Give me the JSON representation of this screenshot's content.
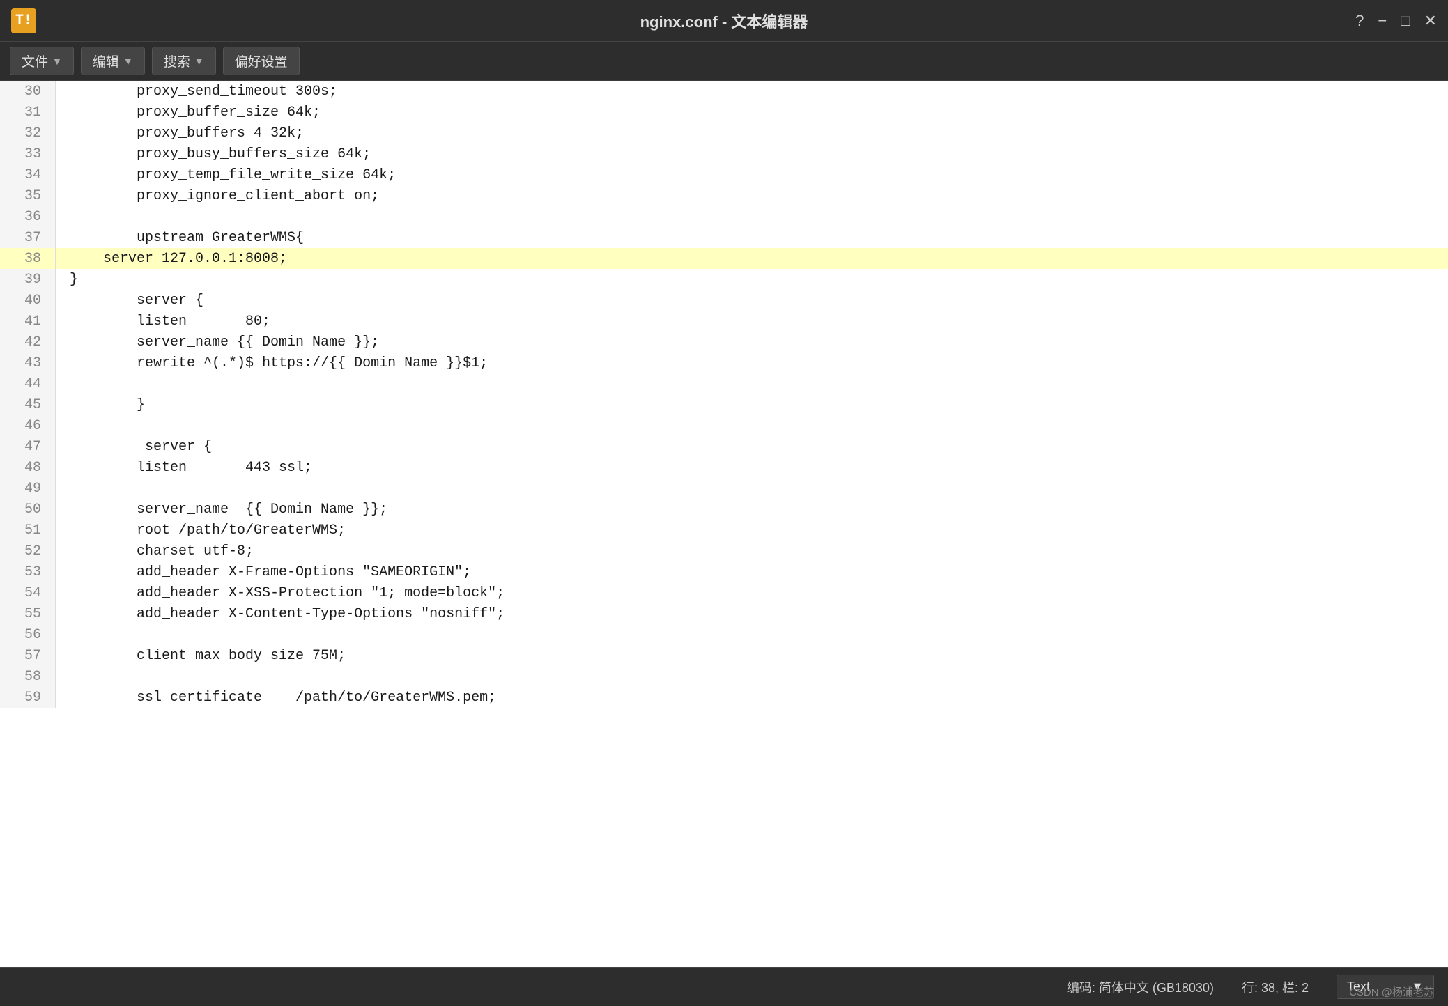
{
  "titlebar": {
    "app_icon": "T!",
    "title": "nginx.conf - 文本编辑器",
    "help_btn": "?",
    "minimize_btn": "−",
    "maximize_btn": "□",
    "close_btn": "✕"
  },
  "menubar": {
    "file_label": "文件",
    "edit_label": "编辑",
    "search_label": "搜索",
    "prefs_label": "偏好设置"
  },
  "lines": [
    {
      "num": "30",
      "text": "        proxy_send_timeout 300s;",
      "highlighted": false
    },
    {
      "num": "31",
      "text": "        proxy_buffer_size 64k;",
      "highlighted": false
    },
    {
      "num": "32",
      "text": "        proxy_buffers 4 32k;",
      "highlighted": false
    },
    {
      "num": "33",
      "text": "        proxy_busy_buffers_size 64k;",
      "highlighted": false
    },
    {
      "num": "34",
      "text": "        proxy_temp_file_write_size 64k;",
      "highlighted": false
    },
    {
      "num": "35",
      "text": "        proxy_ignore_client_abort on;",
      "highlighted": false
    },
    {
      "num": "36",
      "text": "",
      "highlighted": false
    },
    {
      "num": "37",
      "text": "        upstream GreaterWMS{",
      "highlighted": false
    },
    {
      "num": "38",
      "text": "    server 127.0.0.1:8008;",
      "highlighted": true
    },
    {
      "num": "39",
      "text": "}",
      "highlighted": false
    },
    {
      "num": "40",
      "text": "        server {",
      "highlighted": false
    },
    {
      "num": "41",
      "text": "        listen       80;",
      "highlighted": false
    },
    {
      "num": "42",
      "text": "        server_name {{ Domin Name }};",
      "highlighted": false
    },
    {
      "num": "43",
      "text": "        rewrite ^(.*)$ https://{{ Domin Name }}$1;",
      "highlighted": false
    },
    {
      "num": "44",
      "text": "",
      "highlighted": false
    },
    {
      "num": "45",
      "text": "        }",
      "highlighted": false
    },
    {
      "num": "46",
      "text": "",
      "highlighted": false
    },
    {
      "num": "47",
      "text": "         server {",
      "highlighted": false
    },
    {
      "num": "48",
      "text": "        listen       443 ssl;",
      "highlighted": false
    },
    {
      "num": "49",
      "text": "",
      "highlighted": false
    },
    {
      "num": "50",
      "text": "        server_name  {{ Domin Name }};",
      "highlighted": false
    },
    {
      "num": "51",
      "text": "        root /path/to/GreaterWMS;",
      "highlighted": false
    },
    {
      "num": "52",
      "text": "        charset utf-8;",
      "highlighted": false
    },
    {
      "num": "53",
      "text": "        add_header X-Frame-Options \"SAMEORIGIN\";",
      "highlighted": false
    },
    {
      "num": "54",
      "text": "        add_header X-XSS-Protection \"1; mode=block\";",
      "highlighted": false
    },
    {
      "num": "55",
      "text": "        add_header X-Content-Type-Options \"nosniff\";",
      "highlighted": false
    },
    {
      "num": "56",
      "text": "",
      "highlighted": false
    },
    {
      "num": "57",
      "text": "        client_max_body_size 75M;",
      "highlighted": false
    },
    {
      "num": "58",
      "text": "",
      "highlighted": false
    },
    {
      "num": "59",
      "text": "        ssl_certificate    /path/to/GreaterWMS.pem;",
      "highlighted": false
    }
  ],
  "statusbar": {
    "encoding_label": "编码: 简体中文 (GB18030)",
    "position_label": "行: 38, 栏: 2",
    "format_label": "Text",
    "dropdown_arrow": "▼"
  },
  "watermark": "CSDN @杨浦老苏"
}
